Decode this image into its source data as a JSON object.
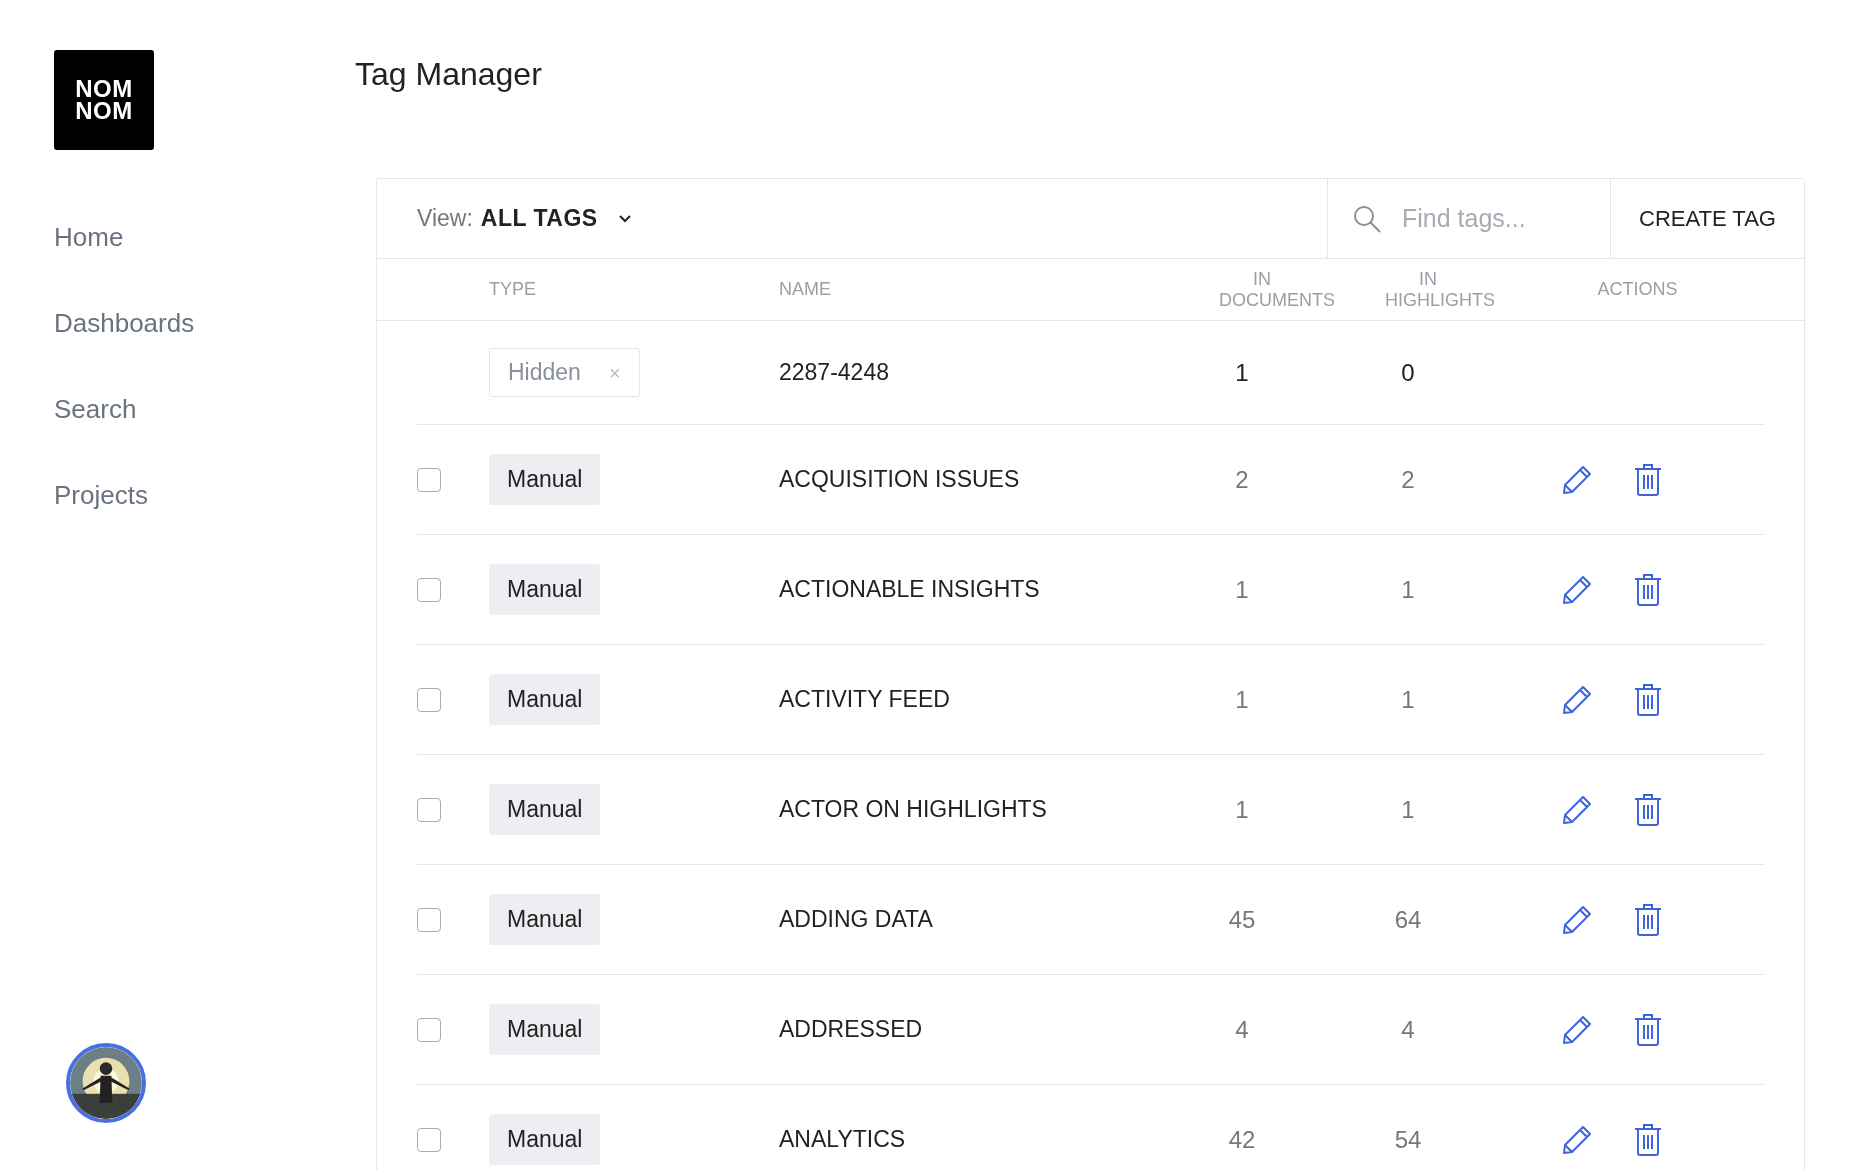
{
  "logo": {
    "lines": [
      "NOM",
      "NOM"
    ]
  },
  "page_title": "Tag Manager",
  "sidebar": {
    "items": [
      {
        "label": "Home"
      },
      {
        "label": "Dashboards"
      },
      {
        "label": "Search"
      },
      {
        "label": "Projects"
      }
    ]
  },
  "toolbar": {
    "view_label": "View:",
    "view_value": "ALL TAGS",
    "search": {
      "placeholder": "Find tags..."
    },
    "create_button": "CREATE TAG"
  },
  "table": {
    "columns": [
      {
        "label": "TYPE"
      },
      {
        "label": "NAME"
      },
      {
        "label": "IN DOCUMENTS"
      },
      {
        "label": "IN HIGHLIGHTS"
      },
      {
        "label": "ACTIONS"
      }
    ],
    "rows": [
      {
        "kind": "hidden",
        "type": "Hidden",
        "remove": "×",
        "name": "2287-4248",
        "in_documents": "1",
        "in_highlights": "0"
      },
      {
        "kind": "manual",
        "checked": false,
        "type": "Manual",
        "name": "ACQUISITION ISSUES",
        "in_documents": "2",
        "in_highlights": "2"
      },
      {
        "kind": "manual",
        "checked": false,
        "type": "Manual",
        "name": "ACTIONABLE INSIGHTS",
        "in_documents": "1",
        "in_highlights": "1"
      },
      {
        "kind": "manual",
        "checked": false,
        "type": "Manual",
        "name": "ACTIVITY FEED",
        "in_documents": "1",
        "in_highlights": "1"
      },
      {
        "kind": "manual",
        "checked": false,
        "type": "Manual",
        "name": "ACTOR ON HIGHLIGHTS",
        "in_documents": "1",
        "in_highlights": "1"
      },
      {
        "kind": "manual",
        "checked": false,
        "type": "Manual",
        "name": "ADDING DATA",
        "in_documents": "45",
        "in_highlights": "64"
      },
      {
        "kind": "manual",
        "checked": false,
        "type": "Manual",
        "name": "ADDRESSED",
        "in_documents": "4",
        "in_highlights": "4"
      },
      {
        "kind": "manual",
        "checked": false,
        "type": "Manual",
        "name": "ANALYTICS",
        "in_documents": "42",
        "in_highlights": "54"
      }
    ]
  }
}
